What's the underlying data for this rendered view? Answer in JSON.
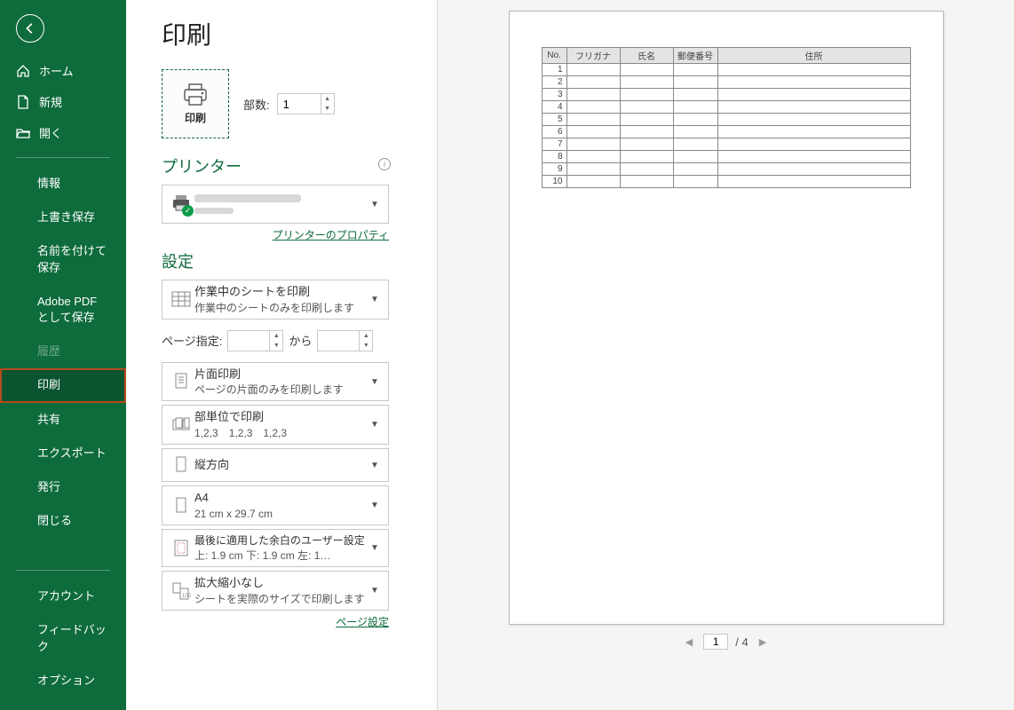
{
  "sidebar": {
    "home": "ホーム",
    "new": "新規",
    "open": "開く",
    "info": "情報",
    "save": "上書き保存",
    "saveas": "名前を付けて保存",
    "adobe": "Adobe PDF として保存",
    "history": "履歴",
    "print": "印刷",
    "share": "共有",
    "export": "エクスポート",
    "publish": "発行",
    "close": "閉じる",
    "account": "アカウント",
    "feedback": "フィードバック",
    "options": "オプション"
  },
  "header": {
    "title": "印刷"
  },
  "print": {
    "button_label": "印刷",
    "copies_label": "部数:",
    "copies_value": "1"
  },
  "printer": {
    "section_title": "プリンター",
    "properties_link": "プリンターのプロパティ"
  },
  "settings": {
    "section_title": "設定",
    "scope": {
      "title": "作業中のシートを印刷",
      "sub": "作業中のシートのみを印刷します"
    },
    "pages_label": "ページ指定:",
    "pages_to": "から",
    "sides": {
      "title": "片面印刷",
      "sub": "ページの片面のみを印刷します"
    },
    "collate": {
      "title": "部単位で印刷",
      "sub": "1,2,3　1,2,3　1,2,3"
    },
    "orientation": {
      "title": "縦方向"
    },
    "paper": {
      "title": "A4",
      "sub": "21 cm x 29.7 cm"
    },
    "margins": {
      "title": "最後に適用した余白のユーザー設定",
      "sub": "上: 1.9 cm 下: 1.9 cm 左: 1…"
    },
    "scaling": {
      "title": "拡大縮小なし",
      "sub": "シートを実際のサイズで印刷します"
    },
    "page_setup_link": "ページ設定"
  },
  "preview": {
    "columns": [
      "No.",
      "フリガナ",
      "氏名",
      "郵便番号",
      "住所"
    ],
    "rows": [
      "1",
      "2",
      "3",
      "4",
      "5",
      "6",
      "7",
      "8",
      "9",
      "10"
    ],
    "current_page": "1",
    "total_label": "/ 4"
  }
}
